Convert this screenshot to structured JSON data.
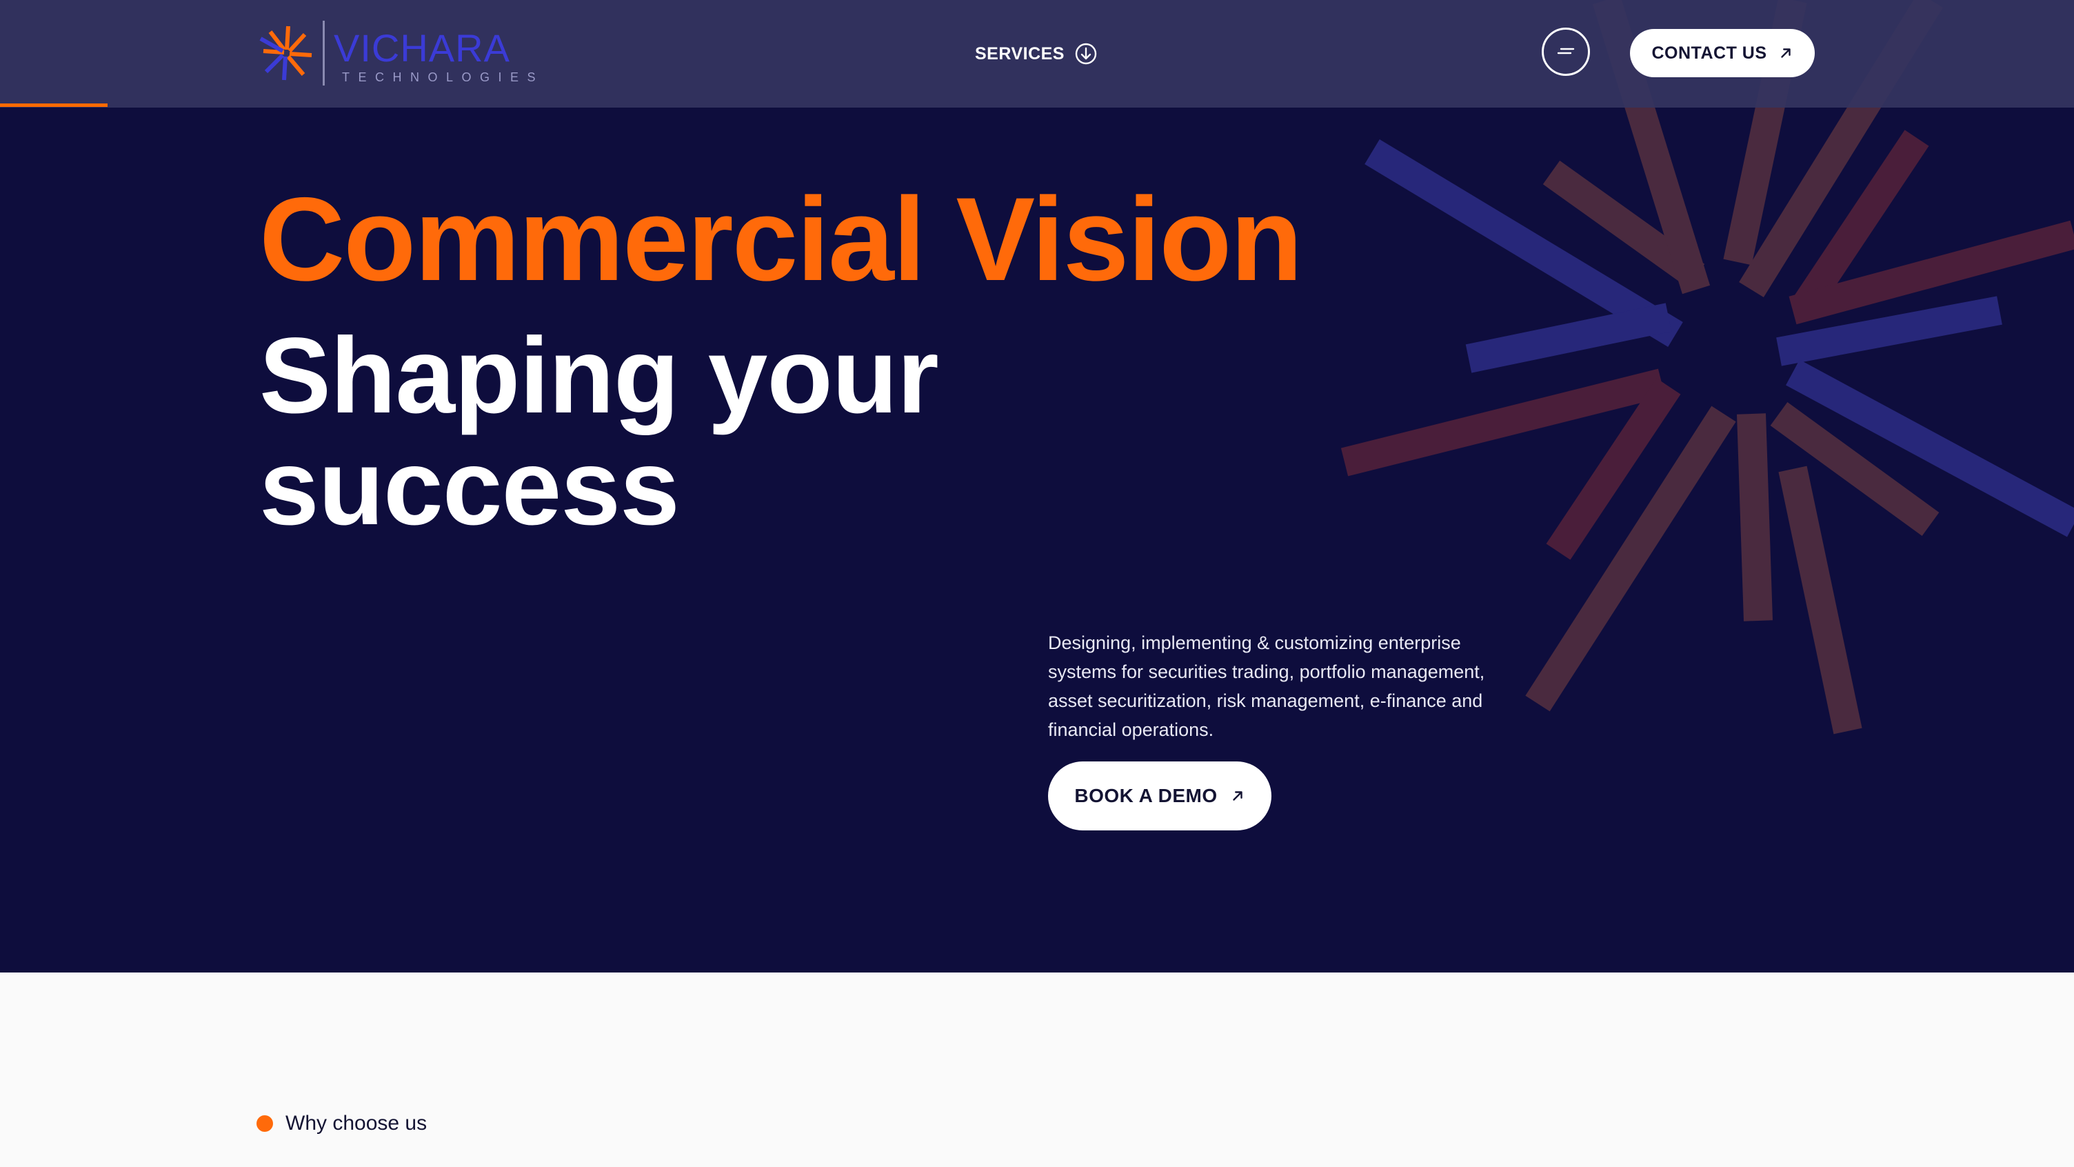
{
  "brand": {
    "name": "VICHARA",
    "tagline": "TECHNOLOGIES",
    "colors": {
      "navy": "#0E0D3D",
      "orange": "#FF6A0A",
      "blue": "#3B3BD6",
      "maroon": "#5A1E3A"
    }
  },
  "nav": {
    "services_label": "SERVICES",
    "services_icon": "arrow-down-circle-icon",
    "menu_icon": "menu-icon",
    "contact_label": "CONTACT US",
    "contact_icon": "arrow-up-right-icon"
  },
  "hero": {
    "headline_accent": "Commercial Vision",
    "headline_main": "Shaping your success",
    "description": "Designing, implementing & customizing enterprise systems for securities trading, portfolio management, asset securitization, risk management, e-finance and financial operations.",
    "cta_label": "BOOK A DEMO",
    "cta_icon": "arrow-up-right-icon"
  },
  "why": {
    "label": "Why choose us"
  }
}
